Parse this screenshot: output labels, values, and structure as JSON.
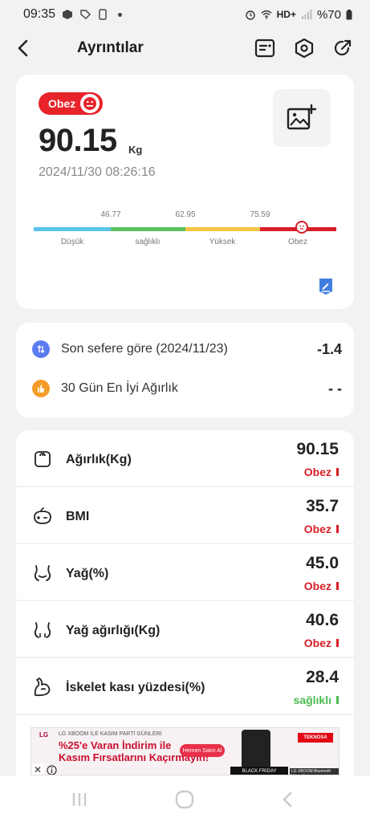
{
  "status_bar": {
    "time": "09:35",
    "network": "HD+",
    "battery": "%70"
  },
  "header": {
    "title": "Ayrıntılar"
  },
  "summary": {
    "status_label": "Obez",
    "weight": "90.15",
    "unit": "Kg",
    "datetime": "2024/11/30 08:26:16",
    "scale": {
      "thresholds": [
        "46.77",
        "62.95",
        "75.59"
      ],
      "zones": [
        "Düşük",
        "sağlıklı",
        "Yüksek",
        "Obez"
      ],
      "zone_colors": [
        "#5bc4ea",
        "#5cc15f",
        "#f5c542",
        "#d81f27"
      ],
      "current_zone": "Obez"
    }
  },
  "comparison": {
    "rows": [
      {
        "label": "Son sefere göre (2024/11/23)",
        "value": "-1.4",
        "icon": "compare-icon",
        "color": "#5b7cf0"
      },
      {
        "label": "30 Gün En İyi Ağırlık",
        "value": "- -",
        "icon": "thumbs-up-icon",
        "color": "#f59b2b"
      }
    ]
  },
  "metrics": [
    {
      "label": "Ağırlık(Kg)",
      "value": "90.15",
      "status": "Obez",
      "status_color": "#d81f27",
      "icon": "scale-icon"
    },
    {
      "label": "BMI",
      "value": "35.7",
      "status": "Obez",
      "status_color": "#d81f27",
      "icon": "bmi-icon"
    },
    {
      "label": "Yağ(%)",
      "value": "45.0",
      "status": "Obez",
      "status_color": "#d81f27",
      "icon": "body-fat-icon"
    },
    {
      "label": "Yağ ağırlığı(Kg)",
      "value": "40.6",
      "status": "Obez",
      "status_color": "#d81f27",
      "icon": "fat-mass-icon"
    },
    {
      "label": "İskelet kası yüzdesi(%)",
      "value": "28.4",
      "status": "sağlıklı",
      "status_color": "#4cbb4f",
      "icon": "muscle-icon"
    }
  ],
  "ad": {
    "brand": "LG",
    "line1": "LG XBOOM İLE KASIM PARTİ GÜNLERİ",
    "line2": "%25'e Varan İndirim ile",
    "line3": "Kasım Fırsatlarını Kaçırmayın!",
    "cta": "Hemen Satın Al",
    "badge": "BLACK FRIDAY",
    "retailer": "TEKNOSA",
    "product_tag": "LG XBOOM Bluetooth Hoparlör",
    "close_label": "✕"
  },
  "colors": {
    "accent_red": "#d81f27",
    "accent_green": "#4cbb4f",
    "background": "#f2f2f4"
  }
}
